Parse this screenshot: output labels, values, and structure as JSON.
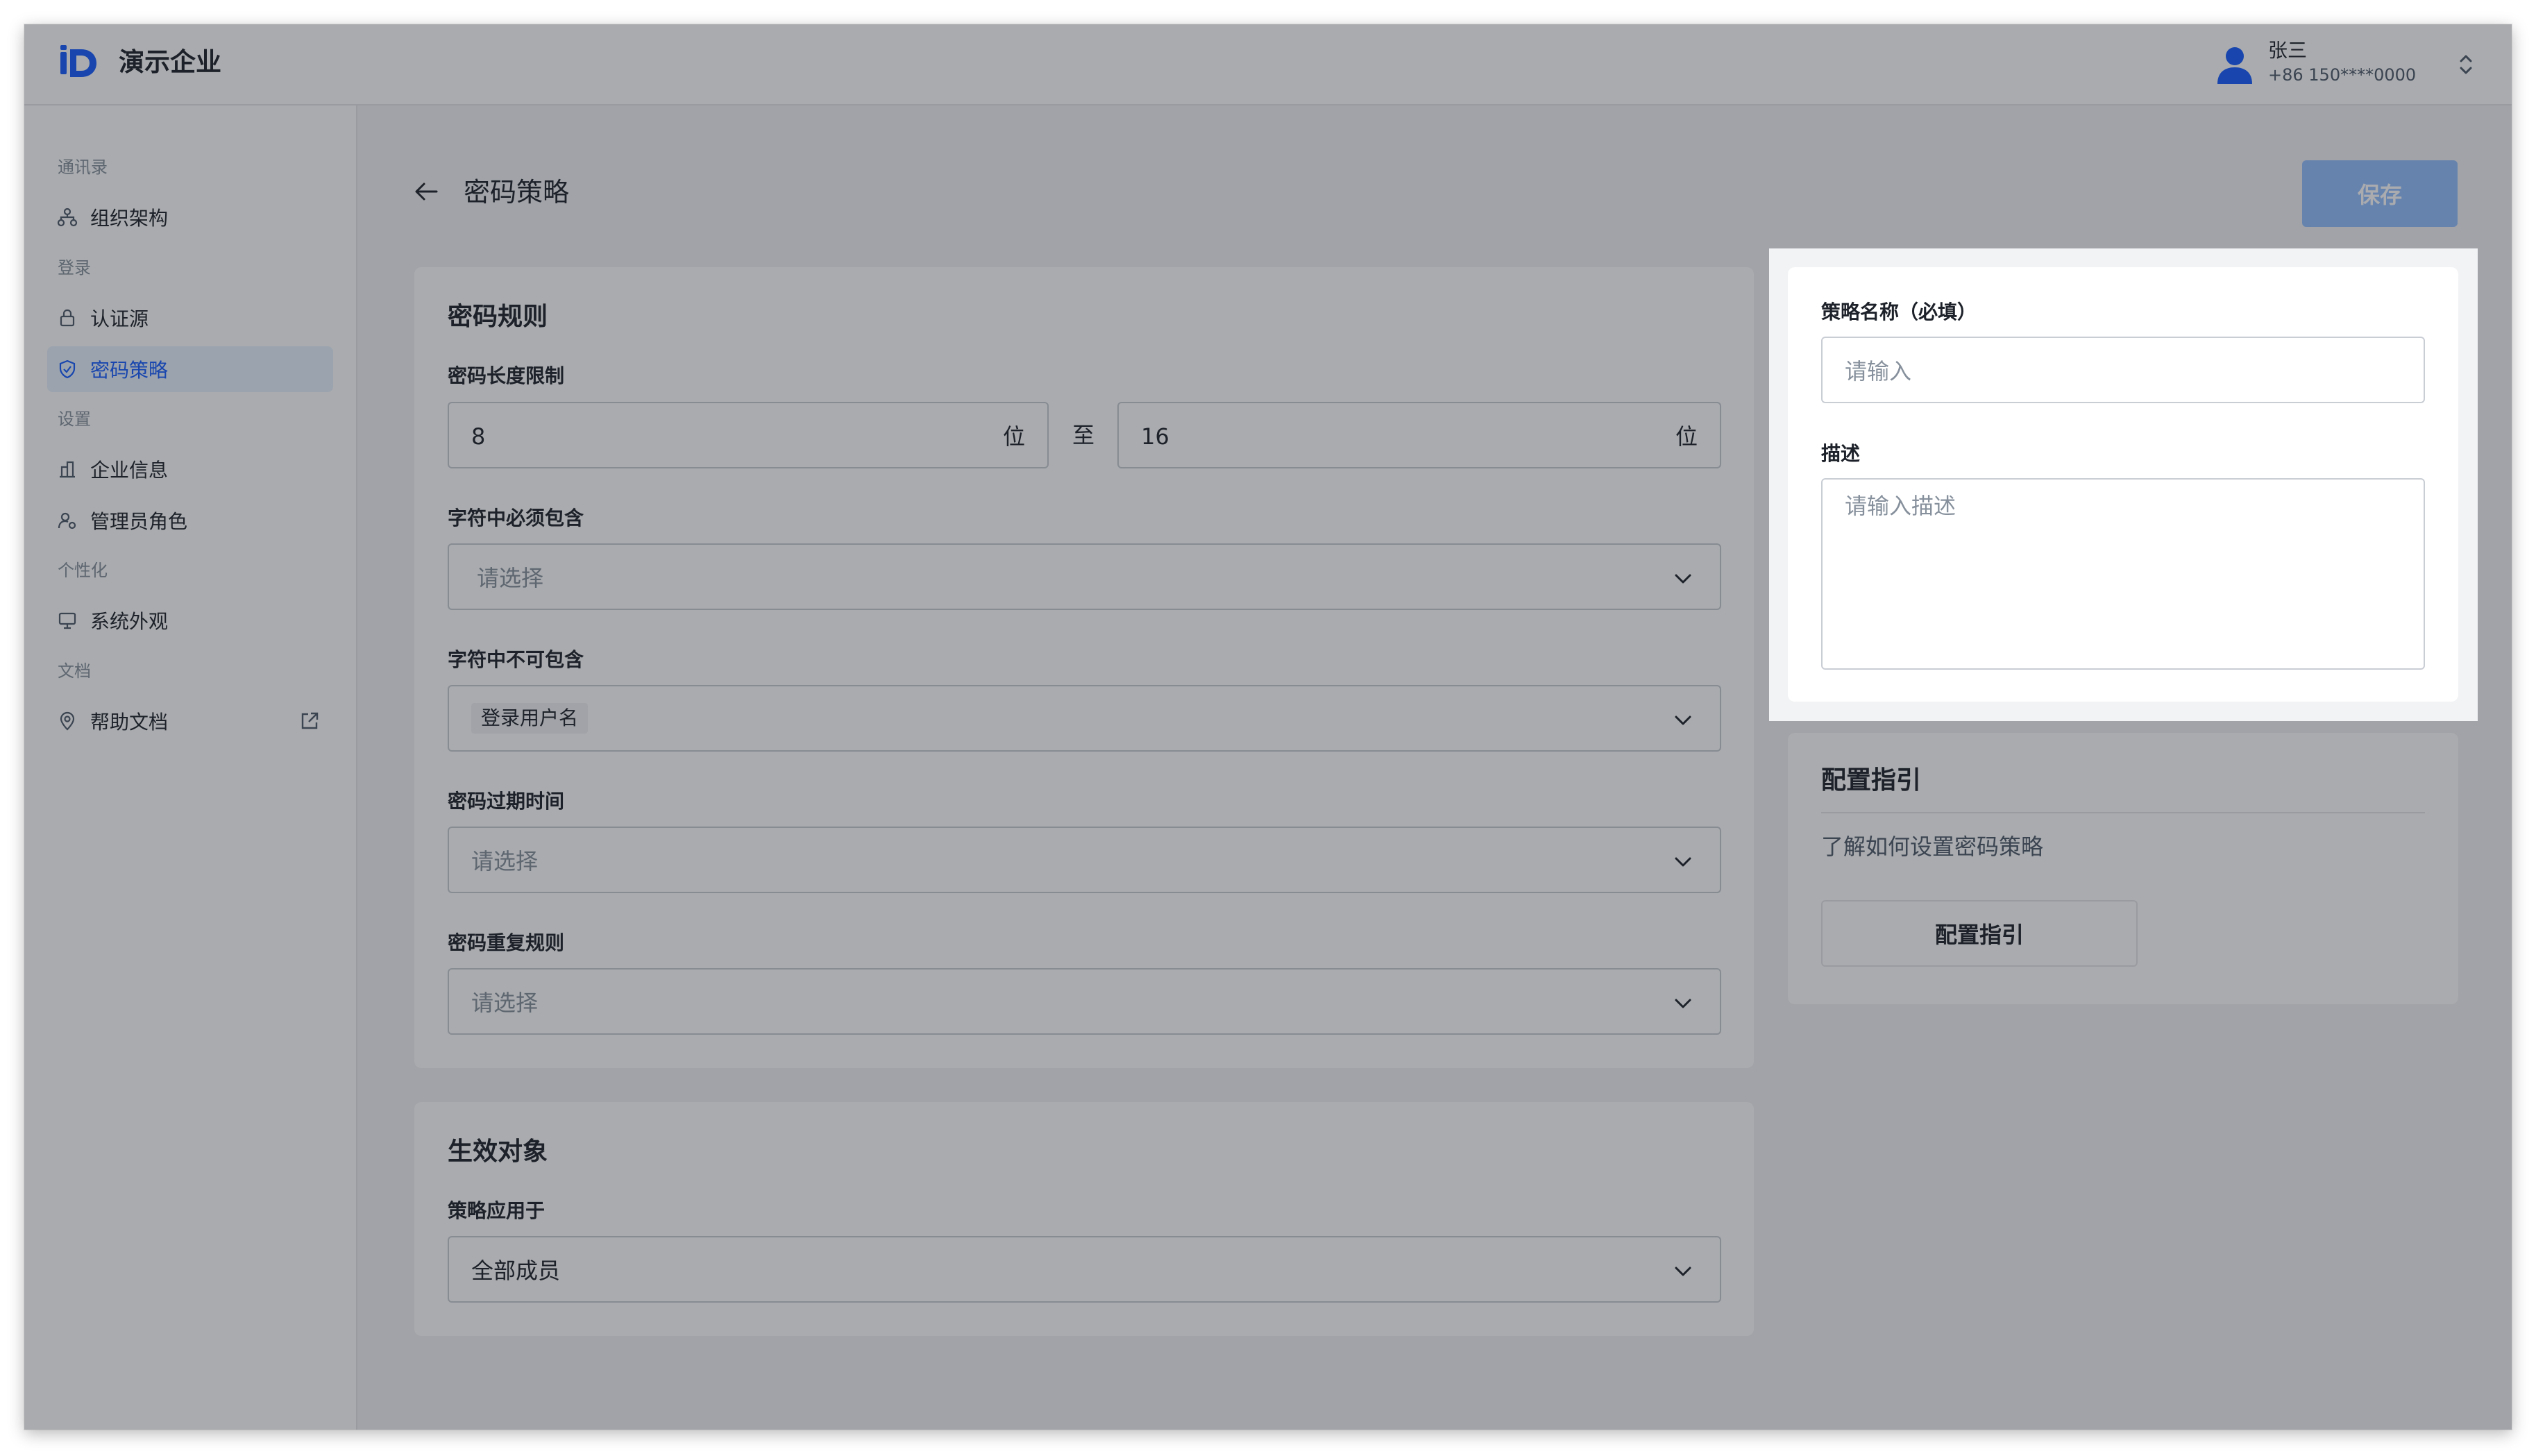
{
  "app": {
    "brand": "演示企业",
    "colors": {
      "primary": "#165dff",
      "primary_disabled": "#94bfff",
      "sidebar_active_bg": "#e8f3ff"
    }
  },
  "user": {
    "name": "张三",
    "phone": "+86 150****0000",
    "icon": "user-avatar-icon"
  },
  "sidebar": {
    "groups": [
      {
        "label": "通讯录",
        "items": [
          {
            "label": "组织架构",
            "icon": "org-chart-icon"
          }
        ]
      },
      {
        "label": "登录",
        "items": [
          {
            "label": "认证源",
            "icon": "lock-icon"
          },
          {
            "label": "密码策略",
            "icon": "shield-icon",
            "active": true
          }
        ]
      },
      {
        "label": "设置",
        "items": [
          {
            "label": "企业信息",
            "icon": "building-icon"
          },
          {
            "label": "管理员角色",
            "icon": "admin-user-icon"
          }
        ]
      },
      {
        "label": "个性化",
        "items": [
          {
            "label": "系统外观",
            "icon": "monitor-icon"
          }
        ]
      },
      {
        "label": "文档",
        "items": [
          {
            "label": "帮助文档",
            "icon": "location-pin-icon",
            "external": true
          }
        ]
      }
    ]
  },
  "page": {
    "title": "密码策略",
    "save_label": "保存"
  },
  "password_rules": {
    "title": "密码规则",
    "length": {
      "label": "密码长度限制",
      "min": "8",
      "max": "16",
      "unit": "位",
      "separator": "至"
    },
    "must_include": {
      "label": "字符中必须包含",
      "placeholder": "请选择"
    },
    "must_not_include": {
      "label": "字符中不可包含",
      "tag": "登录用户名"
    },
    "expiry": {
      "label": "密码过期时间",
      "placeholder": "请选择"
    },
    "repeat": {
      "label": "密码重复规则",
      "placeholder": "请选择"
    }
  },
  "effective_target": {
    "title": "生效对象",
    "apply_to": {
      "label": "策略应用于",
      "value": "全部成员"
    }
  },
  "policy_form": {
    "name": {
      "label": "策略名称（必填）",
      "placeholder": "请输入"
    },
    "description": {
      "label": "描述",
      "placeholder": "请输入描述"
    }
  },
  "guide": {
    "title": "配置指引",
    "description": "了解如何设置密码策略",
    "button_label": "配置指引"
  }
}
